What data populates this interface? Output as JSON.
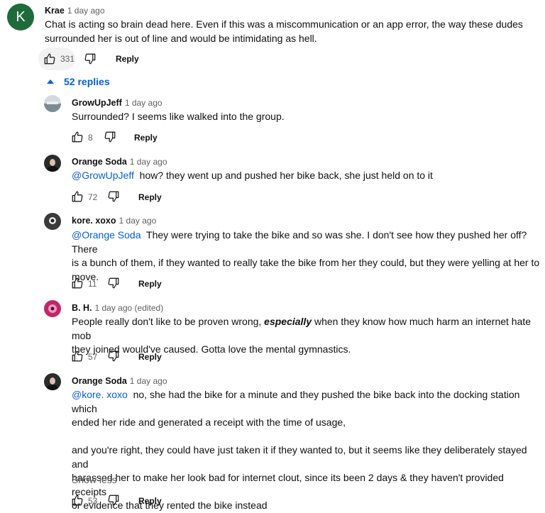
{
  "top_comment": {
    "avatar_letter": "K",
    "avatar_color": "#1f6b3a",
    "author": "Krae",
    "time": "1 day ago",
    "text_line1": "Chat is acting so brain dead here. Even if this was a miscommunication or an app error, the way these dudes",
    "text_line2": "surrounded her is out of line and would be intimidating as hell.",
    "likes": "331",
    "reply_label": "Reply"
  },
  "replies_toggle": {
    "label": "52 replies"
  },
  "replies": [
    {
      "author": "GrowUpJeff",
      "time": "1 day ago",
      "text": "Surrounded? I seems like walked into the group.",
      "likes": "8",
      "reply_label": "Reply"
    },
    {
      "author": "Orange Soda",
      "time": "1 day ago",
      "mention": "@GrowUpJeff",
      "text": "how? they went up and pushed her bike back, she just held on to it",
      "likes": "72",
      "reply_label": "Reply"
    },
    {
      "author": "kore. xoxo",
      "time": "1 day ago",
      "mention": "@Orange Soda",
      "text_line1": "They were trying to take the bike and so was she. I don't see how they pushed her off? There",
      "text_line2": "is a bunch of them, if they wanted to really take the bike from her they could, but they were yelling at her to",
      "text_line3": "move.",
      "likes": "11",
      "reply_label": "Reply"
    },
    {
      "author": "B. H.",
      "time": "1 day ago (edited)",
      "text_pre": "People really don't like to be proven wrong, ",
      "text_emph": "especially",
      "text_post": " when they know how much harm an internet hate mob",
      "text_line2": "they joined would've caused. Gotta love the mental gymnastics.",
      "likes": "57",
      "reply_label": "Reply"
    },
    {
      "author": "Orange Soda",
      "time": "1 day ago",
      "mention": "@kore. xoxo",
      "text_line1": "no, she had the bike for a minute and they pushed the bike back into the docking station which",
      "text_line2": "ended her ride and generated a receipt with the time of usage,",
      "text_line3": "and you're right, they could have just taken it if they wanted to, but it seems like they deliberately stayed and",
      "text_line4": "harassed her to make her look bad for internet clout, since its been 2 days & they haven't provided receipts",
      "text_line5": "or evidence that they rented the bike instead",
      "show_less": "Show less",
      "likes": "53",
      "reply_label": "Reply"
    }
  ]
}
